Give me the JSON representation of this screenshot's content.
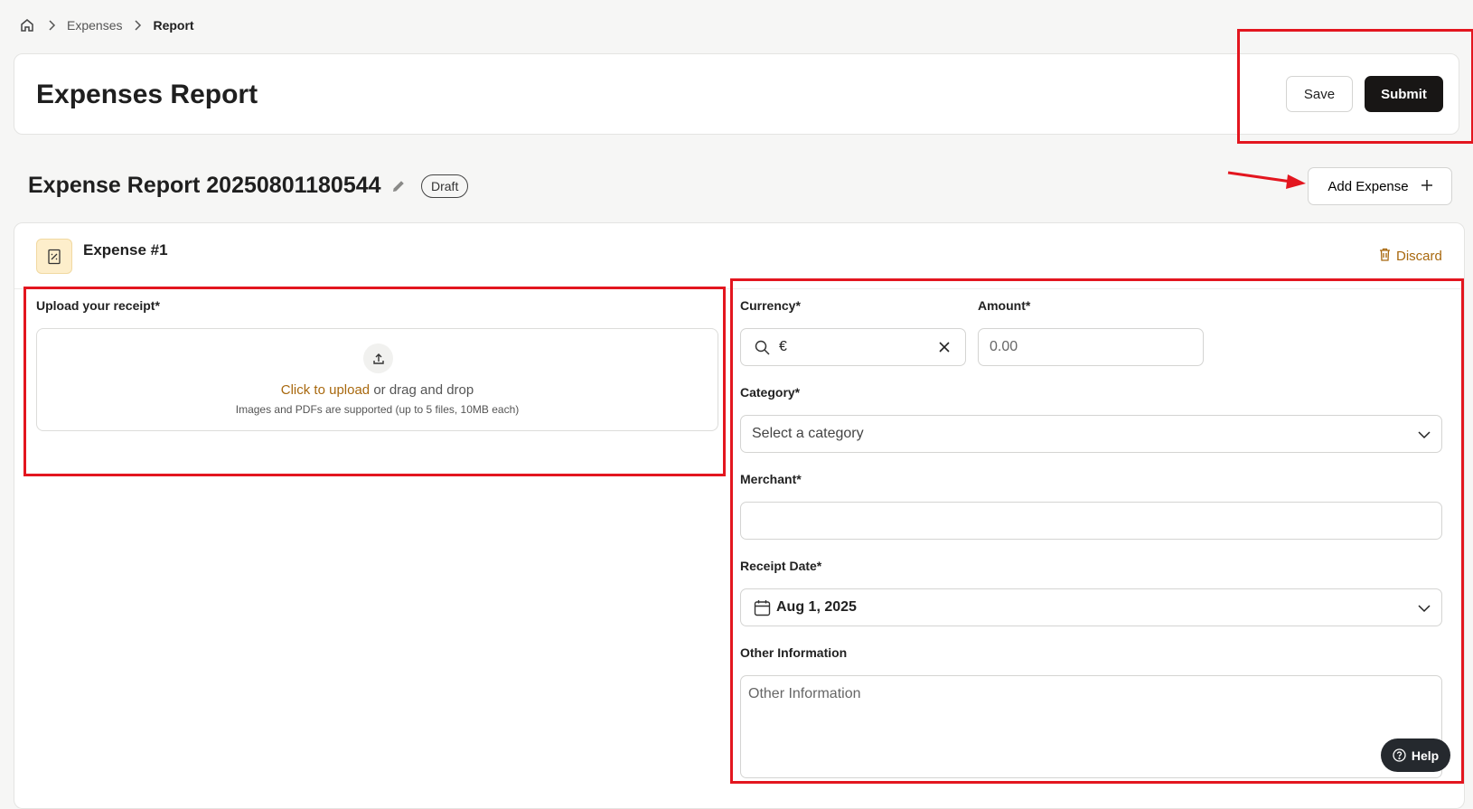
{
  "breadcrumb": {
    "items": [
      "Expenses",
      "Report"
    ]
  },
  "header": {
    "title": "Expenses Report",
    "save_label": "Save",
    "submit_label": "Submit"
  },
  "report": {
    "title": "Expense Report 20250801180544",
    "status": "Draft",
    "add_expense_label": "Add Expense"
  },
  "expense": {
    "title": "Expense #1",
    "discard_label": "Discard",
    "upload": {
      "label": "Upload your receipt*",
      "link_text": "Click to upload",
      "rest_text": " or drag and drop",
      "hint": "Images and PDFs are supported (up to 5 files, 10MB each)"
    },
    "currency": {
      "label": "Currency*",
      "value": "€"
    },
    "amount": {
      "label": "Amount*",
      "placeholder": "0.00"
    },
    "category": {
      "label": "Category*",
      "placeholder": "Select a category"
    },
    "merchant": {
      "label": "Merchant*",
      "value": ""
    },
    "receipt_date": {
      "label": "Receipt Date*",
      "value": "Aug 1, 2025"
    },
    "other_info": {
      "label": "Other Information",
      "placeholder": "Other Information"
    }
  },
  "help": {
    "label": "Help"
  },
  "colors": {
    "accent": "#a8680e",
    "primary_button": "#181615",
    "annotation": "#e3161f"
  }
}
